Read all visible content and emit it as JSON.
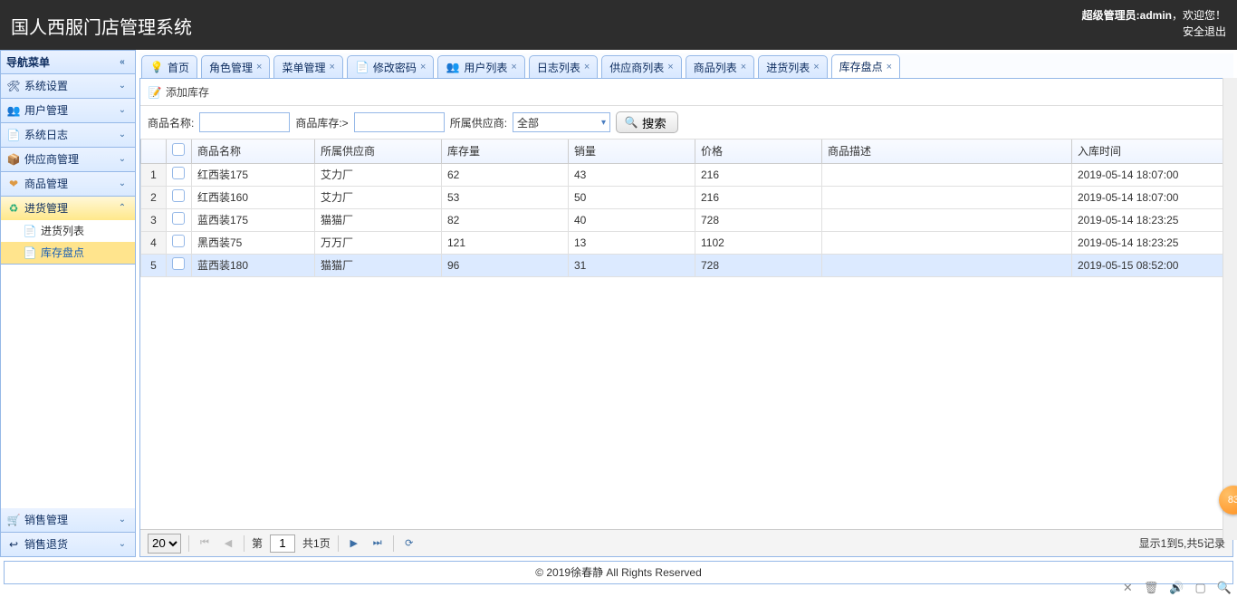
{
  "header": {
    "title": "国人西服门店管理系统",
    "welcome_prefix": "超级管理员:",
    "username": "admin",
    "welcome_suffix": "，欢迎您！",
    "logout": "安全退出"
  },
  "sidebar": {
    "title": "导航菜单",
    "items": [
      {
        "label": "系统设置",
        "icon": "wrench"
      },
      {
        "label": "用户管理",
        "icon": "users"
      },
      {
        "label": "系统日志",
        "icon": "log"
      },
      {
        "label": "供应商管理",
        "icon": "box"
      },
      {
        "label": "商品管理",
        "icon": "heart"
      },
      {
        "label": "进货管理",
        "icon": "refresh",
        "expanded": true,
        "children": [
          {
            "label": "进货列表"
          },
          {
            "label": "库存盘点",
            "selected": true
          }
        ]
      },
      {
        "label": "销售管理",
        "icon": "cart"
      },
      {
        "label": "销售退货",
        "icon": "return"
      }
    ]
  },
  "tabs": [
    {
      "label": "首页",
      "icon": "bulb",
      "closable": false
    },
    {
      "label": "角色管理",
      "closable": true
    },
    {
      "label": "菜单管理",
      "closable": true
    },
    {
      "label": "修改密码",
      "icon": "doc",
      "closable": true
    },
    {
      "label": "用户列表",
      "icon": "users",
      "closable": true
    },
    {
      "label": "日志列表",
      "closable": true
    },
    {
      "label": "供应商列表",
      "closable": true
    },
    {
      "label": "商品列表",
      "closable": true
    },
    {
      "label": "进货列表",
      "closable": true
    },
    {
      "label": "库存盘点",
      "closable": true,
      "active": true
    }
  ],
  "toolbar": {
    "add_stock": "添加库存"
  },
  "search": {
    "name_label": "商品名称:",
    "stock_label": "商品库存:>",
    "supplier_label": "所属供应商:",
    "supplier_value": "全部",
    "button": "搜索"
  },
  "columns": [
    "",
    "",
    "商品名称",
    "所属供应商",
    "库存量",
    "销量",
    "价格",
    "商品描述",
    "入库时间"
  ],
  "rows": [
    {
      "n": "1",
      "name": "红西装175",
      "supplier": "艾力厂",
      "stock": "62",
      "sales": "43",
      "price": "216",
      "desc": "",
      "time": "2019-05-14 18:07:00"
    },
    {
      "n": "2",
      "name": "红西装160",
      "supplier": "艾力厂",
      "stock": "53",
      "sales": "50",
      "price": "216",
      "desc": "",
      "time": "2019-05-14 18:07:00"
    },
    {
      "n": "3",
      "name": "蓝西装175",
      "supplier": "猫猫厂",
      "stock": "82",
      "sales": "40",
      "price": "728",
      "desc": "",
      "time": "2019-05-14 18:23:25"
    },
    {
      "n": "4",
      "name": "黑西装75",
      "supplier": "万万厂",
      "stock": "121",
      "sales": "13",
      "price": "1102",
      "desc": "",
      "time": "2019-05-14 18:23:25"
    },
    {
      "n": "5",
      "name": "蓝西装180",
      "supplier": "猫猫厂",
      "stock": "96",
      "sales": "31",
      "price": "728",
      "desc": "",
      "time": "2019-05-15 08:52:00",
      "selected": true
    }
  ],
  "pager": {
    "page_size": "20",
    "page_prefix": "第",
    "page": "1",
    "total_pages": "共1页",
    "info": "显示1到5,共5记录"
  },
  "footer": "© 2019徐春静 All Rights Reserved",
  "bubble": "83"
}
